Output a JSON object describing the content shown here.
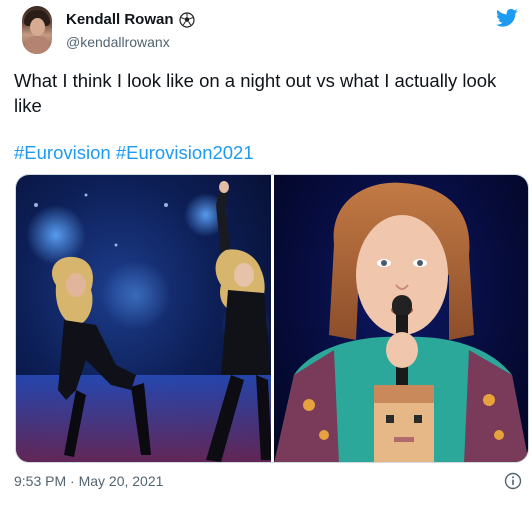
{
  "tweet": {
    "display_name": "Kendall Rowan",
    "handle": "@kendallrowanx",
    "text": "What I think I look like on a night out vs what I actually look like",
    "hashtags": [
      "#Eurovision",
      "#Eurovision2021"
    ],
    "timestamp": "9:53 PM · May 20, 2021"
  },
  "icons": {
    "badge": "soccer-ball-icon",
    "brand": "twitter-bird-icon",
    "info": "info-icon"
  },
  "colors": {
    "link": "#1d9bf0",
    "text": "#0f1419",
    "secondary": "#536471"
  }
}
